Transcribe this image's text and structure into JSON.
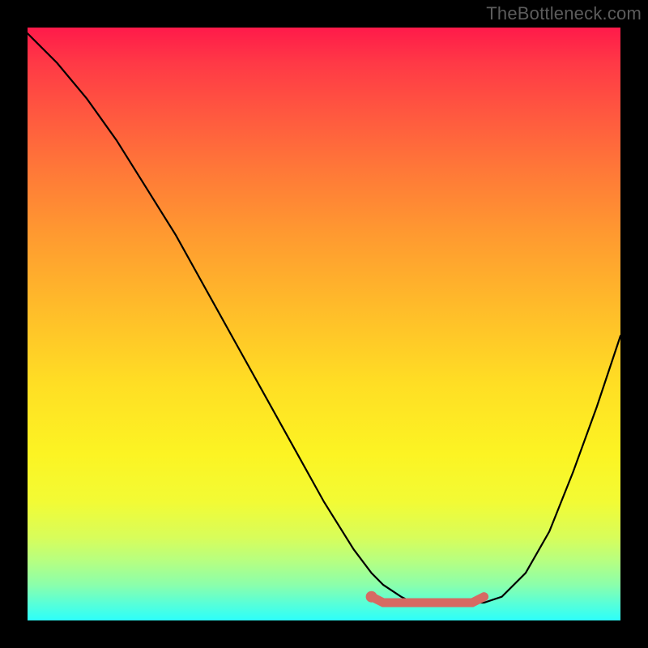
{
  "watermark": "TheBottleneck.com",
  "chart_data": {
    "type": "line",
    "title": "",
    "xlabel": "",
    "ylabel": "",
    "xlim": [
      0,
      100
    ],
    "ylim": [
      0,
      100
    ],
    "series": [
      {
        "name": "bottleneck-curve",
        "color": "#000000",
        "x": [
          0,
          5,
          10,
          15,
          20,
          25,
          30,
          35,
          40,
          45,
          50,
          55,
          58,
          60,
          63,
          65,
          68,
          70,
          73,
          77,
          80,
          84,
          88,
          92,
          96,
          100
        ],
        "values": [
          99,
          94,
          88,
          81,
          73,
          65,
          56,
          47,
          38,
          29,
          20,
          12,
          8,
          6,
          4,
          3,
          3,
          3,
          3,
          3,
          4,
          8,
          15,
          25,
          36,
          48
        ]
      },
      {
        "name": "optimal-segment",
        "color": "#d66a63",
        "x": [
          58,
          60,
          63,
          65,
          68,
          70,
          73,
          75,
          77
        ],
        "values": [
          4,
          3,
          3,
          3,
          3,
          3,
          3,
          3,
          4
        ]
      }
    ],
    "markers": [
      {
        "name": "optimal-point",
        "x": 58,
        "y": 4,
        "color": "#d66a63"
      }
    ]
  }
}
